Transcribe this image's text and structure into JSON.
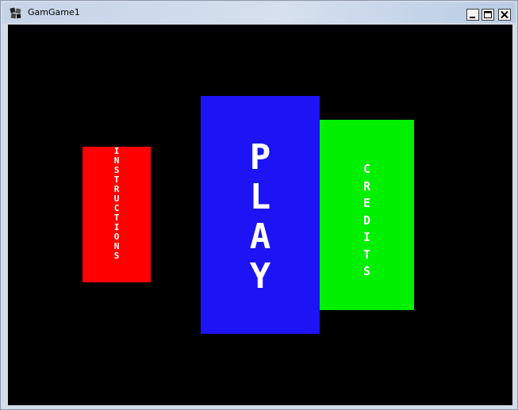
{
  "window": {
    "title": "GamGame1",
    "app_icon": "game-app-icon",
    "controls": {
      "minimize_icon": "minimize-icon",
      "maximize_icon": "maximize-icon",
      "close_icon": "close-icon"
    }
  },
  "menu": {
    "instructions": {
      "label": "INSTRUCTIONS",
      "color": "#ff0000"
    },
    "play": {
      "label": "PLAY",
      "color": "#1c14f4"
    },
    "credits": {
      "label": "CREDITS",
      "color": "#00f000"
    },
    "background_color": "#000000",
    "text_color": "#ffffff"
  }
}
